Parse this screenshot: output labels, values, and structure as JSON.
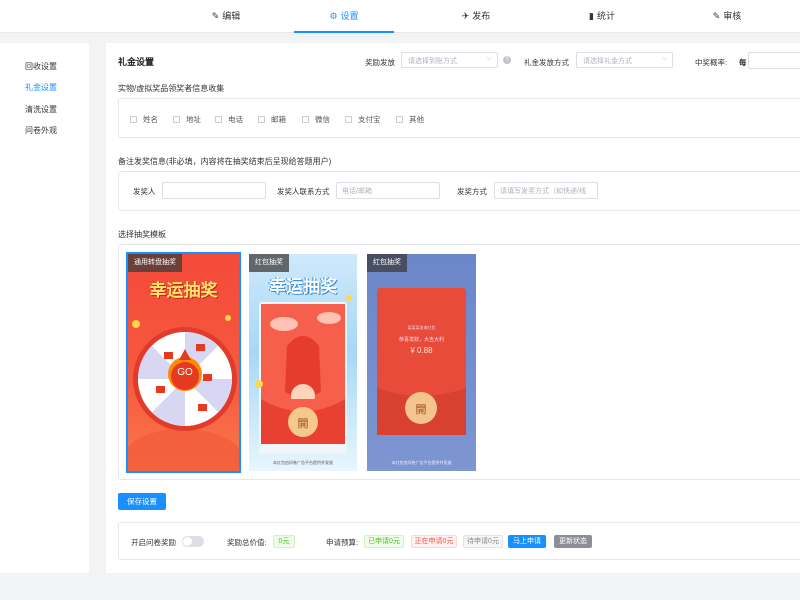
{
  "nav": {
    "items": [
      {
        "icon": "✎",
        "label": "编辑"
      },
      {
        "icon": "⚙",
        "label": "设置"
      },
      {
        "icon": "✈",
        "label": "发布"
      },
      {
        "icon": "▮",
        "label": "统计"
      },
      {
        "icon": "✎",
        "label": "审核"
      }
    ],
    "active_index": 1
  },
  "sidebar": {
    "items": [
      "回收设置",
      "礼金设置",
      "清洗设置",
      "问卷外观"
    ],
    "active_index": 1
  },
  "main": {
    "title": "礼金设置",
    "award_label": "奖励发放",
    "award_select_placeholder": "请选择到账方式",
    "gift_method_label": "礼金发放方式",
    "gift_method_placeholder": "请选择礼金方式",
    "win_rate_label": "中奖概率:",
    "win_rate_prefix": "每",
    "collect_title": "实物/虚拟奖品领奖者信息收集",
    "collect_options": [
      "姓名",
      "地址",
      "电话",
      "邮箱",
      "微信",
      "支付宝",
      "其他"
    ],
    "note_title": "备注发奖信息(非必填，内容将在抽奖结束后呈现给答题用户)",
    "awarder_label": "发奖人",
    "contact_label": "发奖人联系方式",
    "contact_placeholder": "电话/邮箱",
    "method_label": "发奖方式",
    "method_placeholder": "请填写发奖方式（如快递/线",
    "template_title": "选择抽奖模板",
    "templates": [
      {
        "tag": "通用转盘抽奖",
        "heading": "幸运抽奖",
        "go": "GO"
      },
      {
        "tag": "红包抽奖",
        "heading": "幸运抽奖",
        "open": "開",
        "footer": "本红包由问卷广告平台提供并发放"
      },
      {
        "tag": "红包抽奖",
        "sender": "某某某发来红包",
        "greeting": "恭喜发财，大吉大利",
        "amount": "¥ 0.88",
        "open": "開",
        "footer": "本红包由问卷广告平台提供并发放"
      }
    ],
    "save_button": "保存设置",
    "enable_label": "开启问卷奖励",
    "total_label": "奖励总价值:",
    "total_value": "0元",
    "budget_label": "申请预算:",
    "pills": {
      "applied": "已申请0元",
      "applying": "正在申请0元",
      "pending": "待申请0元",
      "apply_now": "马上申请",
      "refresh": "更新状态"
    }
  },
  "colors": {
    "accent": "#1890ff",
    "page_bg": "#f2f3f5",
    "red": "#e8382c",
    "green": "#52c41a"
  }
}
